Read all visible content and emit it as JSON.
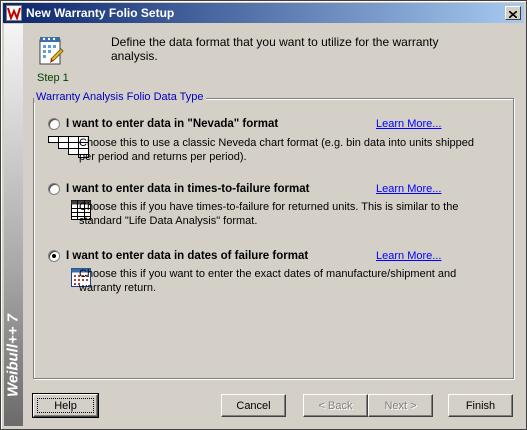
{
  "window": {
    "title": "New Warranty Folio Setup",
    "app_brand": "Weibull++ 7"
  },
  "header": {
    "step_label": "Step 1",
    "description": "Define the data format that you want to utilize for the warranty analysis."
  },
  "group": {
    "legend": "Warranty Analysis Folio Data Type",
    "options": [
      {
        "label": "I want to enter data in \"Nevada\" format",
        "description": "Choose this to use a classic Neveda chart format (e.g. bin data into units shipped per period and returns per period).",
        "learn_more": "Learn More...",
        "selected": false,
        "icon": "nevada-grid-icon"
      },
      {
        "label": "I want to enter data in times-to-failure format",
        "description": "Choose this if you have times-to-failure for returned units. This is similar to the standard \"Life Data Analysis\" format.",
        "learn_more": "Learn More...",
        "selected": false,
        "icon": "table-icon"
      },
      {
        "label": "I want to enter data in dates of failure format",
        "description": "Choose this if you want to enter the exact dates of manufacture/shipment and warranty return.",
        "learn_more": "Learn More...",
        "selected": true,
        "icon": "calendar-icon"
      }
    ]
  },
  "buttons": {
    "help": "Help",
    "cancel": "Cancel",
    "back": "< Back",
    "next": "Next >",
    "finish": "Finish"
  },
  "colors": {
    "titlebar_start": "#0a246a",
    "titlebar_end": "#a6caf0",
    "link": "#0000ff",
    "legend": "#0000c0",
    "face": "#d4d0c8"
  }
}
